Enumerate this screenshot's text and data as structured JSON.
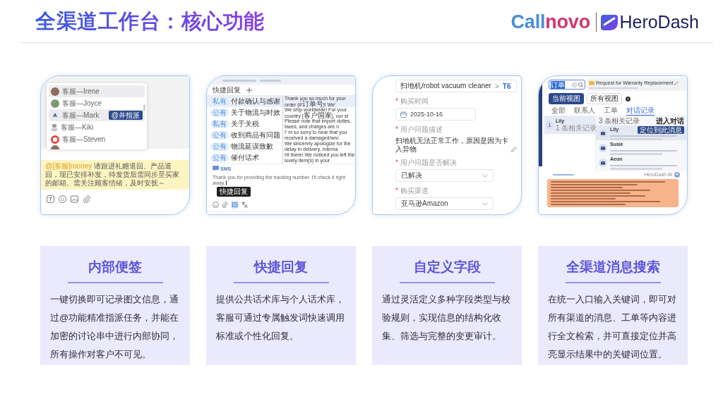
{
  "header": {
    "title": "全渠道工作台：核心功能",
    "brand_logo": [
      {
        "text": "Call",
        "color": "#4b8ed8"
      },
      {
        "text": "novo",
        "color": "#d4346c"
      }
    ],
    "partner_logo": "HeroDash"
  },
  "screenshots": [
    {
      "kind": "internal_note",
      "mention_list": [
        {
          "kind": "photo",
          "name": "客服—Irene",
          "highlighted": true
        },
        {
          "kind": "cartoon",
          "name": "客服—Joyce",
          "highlighted": false
        },
        {
          "kind": "letter",
          "letter": "A",
          "name": "客服—Mark",
          "highlighted": true,
          "action": "@并指派"
        },
        {
          "kind": "figure",
          "name": "客服—Kiki",
          "highlighted": false
        },
        {
          "kind": "ring",
          "name": "客服—Steven",
          "highlighted": false
        },
        {
          "kind": "photo",
          "highlighted": false
        }
      ],
      "note": {
        "mention": "@[客服]rooney",
        "text": "请跟进礼赠退回、产品退回，现已安排补发，待发货后需同步至买家的邮箱。需关注顾客情绪，及时安抚～"
      }
    },
    {
      "kind": "quick_replies",
      "tab": "快捷回复",
      "replies": [
        {
          "scope": "私有",
          "title": "付款确认与感谢",
          "text": "Thank you so much for your order (#订单号)! We'",
          "selected": true
        },
        {
          "scope": "公有",
          "title": "关于物流与时效",
          "text": "We ship worldwide! For your country [客户国家], our st",
          "selected": false
        },
        {
          "scope": "私有",
          "title": "关于关税",
          "text": "Please note that import duties, taxes, and charges are n",
          "selected": false
        },
        {
          "scope": "公有",
          "title": "收到商品有问题",
          "text": "I' m so sorry to hear that you received a damaged/wro",
          "selected": false
        },
        {
          "scope": "公有",
          "title": "物流延误致歉",
          "text": "We sincerely apologize for the delay in delivery. Interna",
          "selected": false
        },
        {
          "scope": "公有",
          "title": "催付话术",
          "text": "Hi there! We noticed you left the lovely item(s) in your",
          "selected": false
        }
      ],
      "channel": "SMS",
      "message": "Thank you for providing the tracking number. I'll check it right away.",
      "tooltip": "快捷回复"
    },
    {
      "kind": "custom_fields",
      "category": {
        "path": "扫地机/robot vacuum cleaner",
        "separator": ">",
        "model": "T6"
      },
      "fields": [
        {
          "kind": "date",
          "marker": "*",
          "label": "购买时间",
          "value": "2025-10-16"
        },
        {
          "kind": "text",
          "marker": "*",
          "label": "用户问题描述",
          "value": "扫地机无法正常工作，原因是因为卡入异物"
        },
        {
          "kind": "select",
          "marker": "*",
          "label": "用户问题是否解决",
          "value": "已解决"
        },
        {
          "kind": "select",
          "marker": "*",
          "label": "购买渠道",
          "value": "亚马逊Amazon"
        }
      ]
    },
    {
      "kind": "message_search",
      "query": "订单",
      "ticket_title": "Request for Warranty Replacement",
      "views": [
        {
          "label": "当前视图",
          "selected": true
        },
        {
          "label": "所有视图",
          "selected": false
        }
      ],
      "filters": [
        {
          "label": "全部",
          "selected": false
        },
        {
          "label": "联系人",
          "selected": false
        },
        {
          "label": "工单",
          "selected": false
        },
        {
          "label": "对话记录",
          "selected": true
        }
      ],
      "contacts": [
        {
          "badge": "1",
          "name": "Lily",
          "count": "1 条相关记录",
          "selected": true
        }
      ],
      "results_count": "3 条相关记录",
      "open_link": "进入对话",
      "results": [
        {
          "name": "Lily",
          "selected": true,
          "action": "定位到此消息"
        },
        {
          "name": "Susie",
          "selected": false
        },
        {
          "name": "Aeon",
          "selected": false
        }
      ],
      "assistant": "HeroDash AI"
    }
  ],
  "features": [
    {
      "title": "内部便签",
      "description": "一键切换即可记录图文信息，通过@功能精准指派任务，并能在加密的讨论串中进行内部协同，所有操作对客户不可见。"
    },
    {
      "title": "快捷回复",
      "description": "提供公共话术库与个人话术库，客服可通过专属触发词快速调用标准或个性化回复。"
    },
    {
      "title": "自定义字段",
      "description": "通过灵活定义多种字段类型与校验规则，实现信息的结构化收集、筛选与完整的变更审计。"
    },
    {
      "title": "全渠道消息搜索",
      "description": "在统一入口输入关键词，即可对所有渠道的消息、工单等内容进行全文检索，并可直接定位并高亮显示结果中的关键词位置。"
    }
  ]
}
